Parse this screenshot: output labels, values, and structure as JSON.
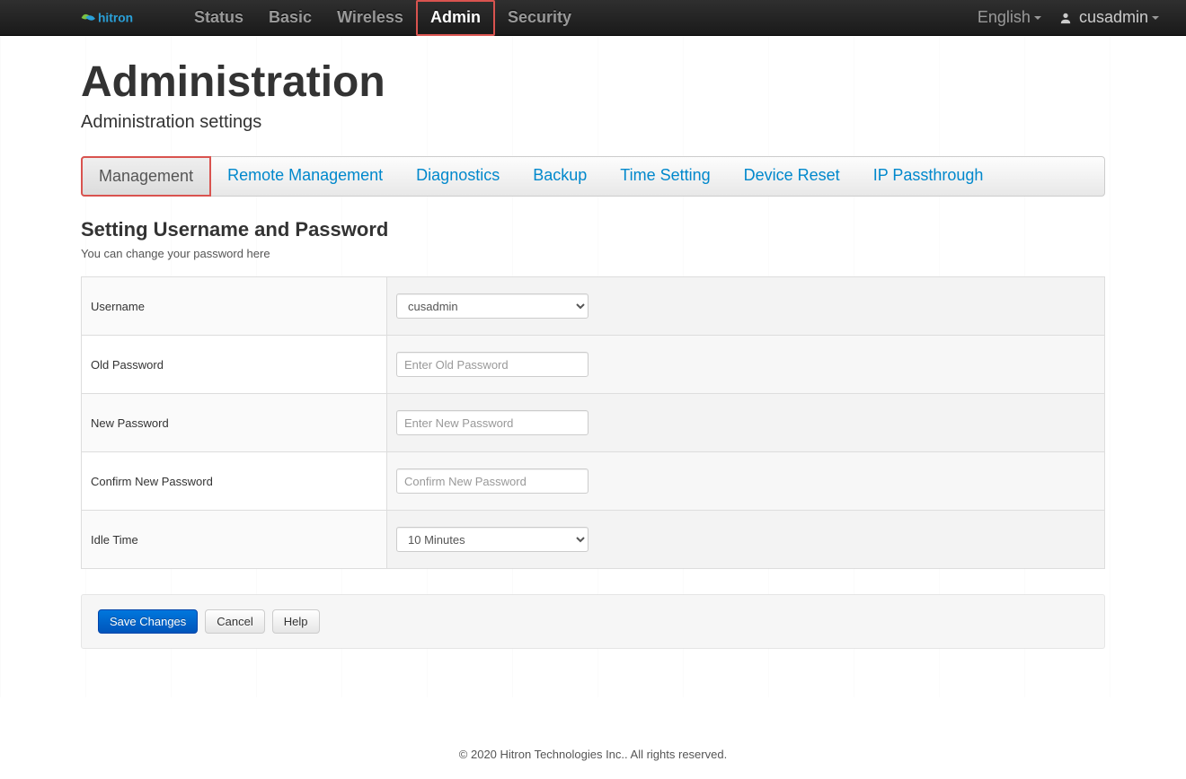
{
  "brand": "hitron",
  "nav": {
    "items": [
      "Status",
      "Basic",
      "Wireless",
      "Admin",
      "Security"
    ],
    "active_index": 3
  },
  "language": "English",
  "user": "cusadmin",
  "page": {
    "title": "Administration",
    "subtitle": "Administration settings"
  },
  "tabs": {
    "items": [
      "Management",
      "Remote Management",
      "Diagnostics",
      "Backup",
      "Time Setting",
      "Device Reset",
      "IP Passthrough"
    ],
    "active_index": 0
  },
  "section": {
    "title": "Setting Username and Password",
    "desc": "You can change your password here"
  },
  "form": {
    "username": {
      "label": "Username",
      "value": "cusadmin"
    },
    "old_password": {
      "label": "Old Password",
      "placeholder": "Enter Old Password"
    },
    "new_password": {
      "label": "New Password",
      "placeholder": "Enter New Password"
    },
    "confirm_password": {
      "label": "Confirm New Password",
      "placeholder": "Confirm New Password"
    },
    "idle_time": {
      "label": "Idle Time",
      "value": "10 Minutes"
    }
  },
  "buttons": {
    "save": "Save Changes",
    "cancel": "Cancel",
    "help": "Help"
  },
  "footer": "© 2020 Hitron Technologies Inc.. All rights reserved."
}
